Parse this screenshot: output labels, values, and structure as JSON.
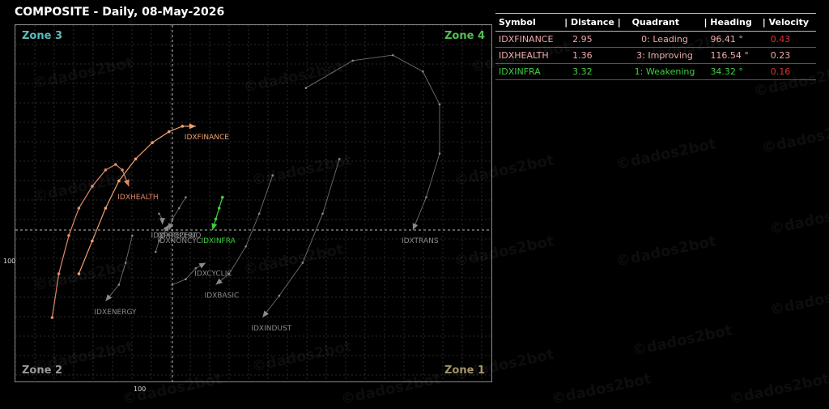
{
  "title": "COMPOSITE - Daily, 08-May-2026",
  "zones": {
    "top_left": "Zone 3",
    "top_right": "Zone 4",
    "bottom_left": "Zone 2",
    "bottom_right": "Zone 1"
  },
  "colors": {
    "zone3": "#5bbcbc",
    "zone4": "#4fc04f",
    "zone2": "#999999",
    "zone1": "#a39266",
    "finance": "#f0a070",
    "health": "#e08868",
    "infra": "#3ecf3e",
    "gray": "#8a8a8a",
    "velocity_red": "#e03030",
    "velocity_normal": "#dddddd"
  },
  "watermark_text": "©dados2bot",
  "table": {
    "headers": [
      "Symbol",
      "| Distance |",
      "Quadrant",
      "| Heading",
      "| Velocity"
    ],
    "rows": [
      {
        "symbol": "IDXFINANCE",
        "distance": "2.95",
        "quadrant": "0: Leading",
        "heading": "96.41 °",
        "velocity": "0.43",
        "color": "#f0a8a8",
        "velocity_color": "#e03030"
      },
      {
        "symbol": "IDXHEALTH",
        "distance": "1.36",
        "quadrant": "3: Improving",
        "heading": "116.54 °",
        "velocity": "0.23",
        "color": "#f0a8a8",
        "velocity_color": "#f0a8a8"
      },
      {
        "symbol": "IDXINFRA",
        "distance": "3.32",
        "quadrant": "1: Weakening",
        "heading": "34.32 °",
        "velocity": "0.16",
        "color": "#3ecf3e",
        "velocity_color": "#e03030"
      }
    ]
  },
  "chart_data": {
    "type": "scatter",
    "subtype": "relative rotation graph",
    "x_center": 100,
    "y_center": 100,
    "x_ticks": [
      "100"
    ],
    "y_ticks": [
      "100"
    ],
    "grid": true,
    "series": [
      {
        "name": "IDXFINANCE",
        "color": "#f0a070",
        "highlight": true,
        "points": [
          [
            97.2,
            99.2
          ],
          [
            97.6,
            99.8
          ],
          [
            98.0,
            100.4
          ],
          [
            98.4,
            100.9
          ],
          [
            98.9,
            101.3
          ],
          [
            99.4,
            101.6
          ],
          [
            99.9,
            101.8
          ],
          [
            100.3,
            101.9
          ],
          [
            100.7,
            101.9
          ]
        ]
      },
      {
        "name": "IDXHEALTH",
        "color": "#e08868",
        "highlight": true,
        "points": [
          [
            96.4,
            98.4
          ],
          [
            96.6,
            99.2
          ],
          [
            96.9,
            99.9
          ],
          [
            97.2,
            100.4
          ],
          [
            97.6,
            100.8
          ],
          [
            98.0,
            101.1
          ],
          [
            98.3,
            101.2
          ],
          [
            98.5,
            101.1
          ],
          [
            98.7,
            100.8
          ]
        ]
      },
      {
        "name": "IDXINFRA",
        "color": "#3ecf3e",
        "highlight": true,
        "points": [
          [
            101.5,
            100.6
          ],
          [
            101.4,
            100.4
          ],
          [
            101.3,
            100.2
          ],
          [
            101.2,
            100.0
          ]
        ]
      },
      {
        "name": "IDXNONCYC",
        "color": "#8a8a8a",
        "points": [
          [
            100.4,
            100.6
          ],
          [
            100.2,
            100.4
          ],
          [
            100.0,
            100.2
          ],
          [
            99.9,
            100.0
          ]
        ]
      },
      {
        "name": "IDXPROPERT",
        "color": "#8a8a8a",
        "points": [
          [
            99.6,
            100.3
          ],
          [
            99.7,
            100.2
          ],
          [
            99.7,
            100.1
          ]
        ]
      },
      {
        "name": "IDXTECHNO",
        "color": "#8a8a8a",
        "points": [
          [
            99.5,
            99.6
          ],
          [
            99.6,
            99.8
          ],
          [
            99.8,
            100.0
          ],
          [
            99.9,
            100.1
          ]
        ]
      },
      {
        "name": "IDXCYCLIC",
        "color": "#8a8a8a",
        "points": [
          [
            100.0,
            99.0
          ],
          [
            100.4,
            99.1
          ],
          [
            100.7,
            99.3
          ],
          [
            101.0,
            99.4
          ]
        ]
      },
      {
        "name": "IDXBASIC",
        "color": "#8a8a8a",
        "points": [
          [
            103.0,
            101.0
          ],
          [
            102.6,
            100.3
          ],
          [
            102.2,
            99.7
          ],
          [
            101.7,
            99.2
          ],
          [
            101.3,
            99.0
          ]
        ]
      },
      {
        "name": "IDXENERGY",
        "color": "#8a8a8a",
        "points": [
          [
            98.8,
            99.9
          ],
          [
            98.6,
            99.4
          ],
          [
            98.4,
            99.0
          ],
          [
            98.0,
            98.7
          ]
        ]
      },
      {
        "name": "IDXINDUST",
        "color": "#8a8a8a",
        "points": [
          [
            105.0,
            101.3
          ],
          [
            104.5,
            100.3
          ],
          [
            103.9,
            99.4
          ],
          [
            103.2,
            98.8
          ],
          [
            102.7,
            98.4
          ]
        ]
      },
      {
        "name": "IDXTRANS",
        "color": "#8a8a8a",
        "points": [
          [
            104.0,
            102.6
          ],
          [
            105.4,
            103.1
          ],
          [
            106.6,
            103.2
          ],
          [
            107.5,
            102.9
          ],
          [
            108.0,
            102.3
          ],
          [
            108.0,
            101.4
          ],
          [
            107.6,
            100.6
          ],
          [
            107.2,
            100.0
          ]
        ]
      }
    ]
  }
}
